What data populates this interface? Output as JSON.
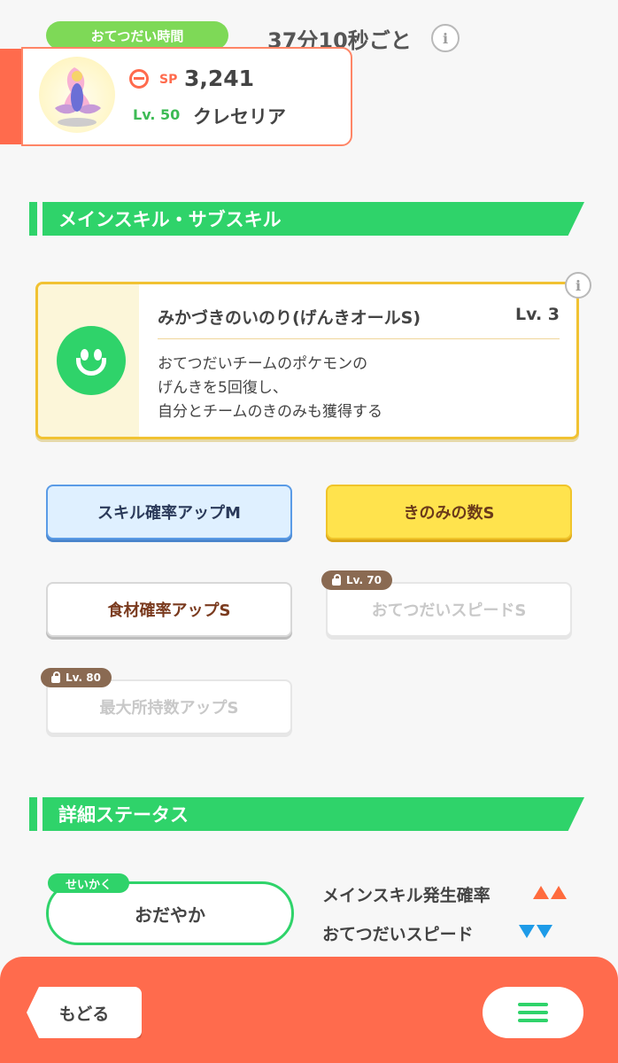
{
  "help": {
    "pill_label": "おてつだい時間",
    "interval": "37分10秒ごと"
  },
  "pokemon": {
    "sp_label": "SP",
    "sp_value": "3,241",
    "level_label": "Lv. 50",
    "name": "クレセリア"
  },
  "sections": {
    "skills_title": "メインスキル・サブスキル",
    "details_title": "詳細ステータス"
  },
  "main_skill": {
    "name": "みかづきのいのり(げんきオールS)",
    "level": "Lv. 3",
    "description_lines": [
      "おてつだいチームのポケモンの",
      "げんきを5回復し、",
      "自分とチームのきのみも獲得する"
    ]
  },
  "sub_skills": [
    {
      "label": "スキル確率アップM",
      "style": "blue",
      "locked": false
    },
    {
      "label": "きのみの数S",
      "style": "gold",
      "locked": false
    },
    {
      "label": "食材確率アップS",
      "style": "white",
      "locked": false
    },
    {
      "label": "おてつだいスピードS",
      "style": "locked",
      "locked": true,
      "lock_level": "Lv. 70"
    },
    {
      "label": "最大所持数アップS",
      "style": "locked",
      "locked": true,
      "lock_level": "Lv. 80"
    }
  ],
  "nature": {
    "tag": "せいかく",
    "value": "おだやか",
    "effects": [
      {
        "label": "メインスキル発生確率",
        "direction": "up"
      },
      {
        "label": "おてつだいスピード",
        "direction": "down"
      }
    ]
  },
  "bottom": {
    "back_label": "もどる"
  },
  "colors": {
    "accent_green": "#2fd36a",
    "accent_orange": "#ff6b4d",
    "gold": "#f1c232"
  },
  "icons": {
    "info": "info-icon",
    "sp": "poke-ball-icon",
    "skill": "smile-icon",
    "lock": "lock-icon",
    "menu": "hamburger-menu-icon"
  }
}
